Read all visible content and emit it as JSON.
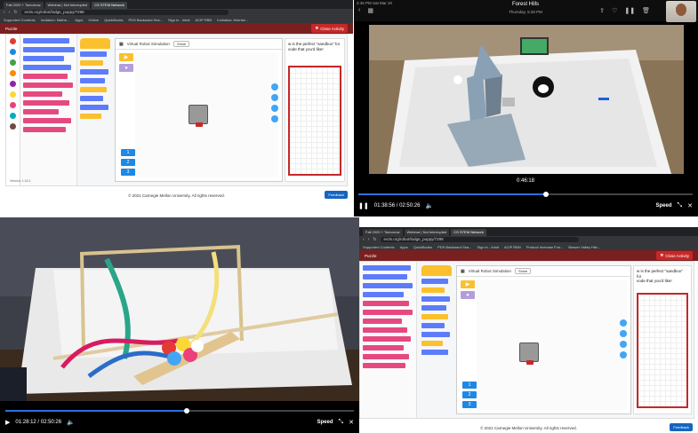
{
  "common": {
    "browser": {
      "tabs": [
        "Fall 2020 + Tomorrow",
        "Webinar | Not Interrupted",
        "CS STEM Network"
      ],
      "url": "ev3s.org/robot/lodge_puppy/7298",
      "bookmarks": [
        "Supported Contents",
        "Invitation: Mathe...",
        "Apps",
        "Gdrive",
        "QuickBooks",
        "PDS Backward Sea...",
        "Sign in - Intuit",
        "ACIP RBN",
        "Invitation: Morrise...",
        "Product Increase Fun...",
        "Beaver Valley Hiki..."
      ],
      "appbar_title": "Puzzle",
      "close_activity": "Close Activity",
      "sim_title": "Virtual Robot Simulation",
      "sim_select": "Shine",
      "desc_text": "w is the perfect \"sandbox\" for\nvode that you'd like!",
      "footer": "© 2021 Carnegie Mellon University. All rights reserved.",
      "feedback": "Feedback",
      "version": "Version: 1.14.0",
      "cam_keys": [
        "1",
        "2",
        "3"
      ]
    }
  },
  "panel_tr": {
    "date": "4:46 PM   Sat Mar 20",
    "title": "Forest Hills",
    "subtitle": "Thursday, 5:28 PM",
    "timestamp_overlay": "0:46:18",
    "time": "01:38:56 / 02:50:26",
    "speed": "Speed",
    "progress": 0.56
  },
  "panel_bl": {
    "time": "01:28:12 / 02:50:26",
    "speed": "Speed",
    "progress": 0.52
  },
  "colors": {
    "accent": "#c62828",
    "progress": "#2f6fe0",
    "maroon": "#7a1f1f"
  }
}
